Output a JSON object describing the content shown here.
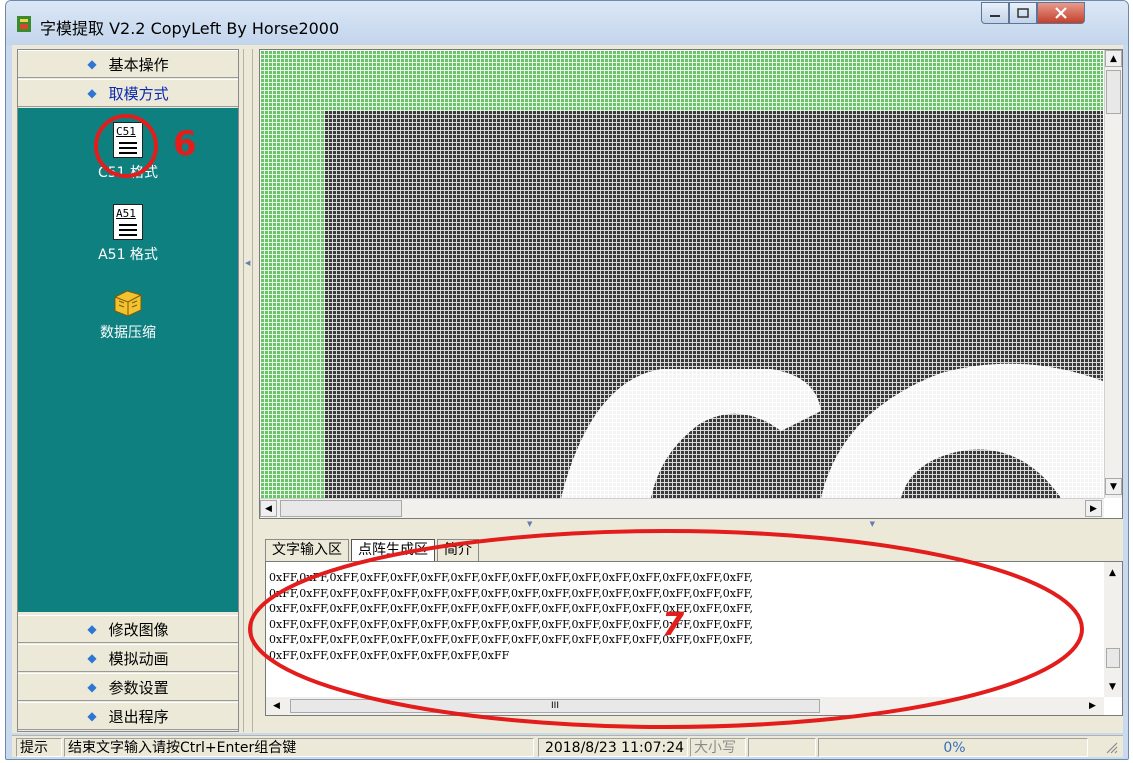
{
  "window": {
    "title": "字模提取 V2.2  CopyLeft By Horse2000"
  },
  "nav": {
    "top_items": [
      {
        "label": "基本操作"
      },
      {
        "label": "取模方式"
      }
    ],
    "tools": [
      {
        "icon_text": "C51",
        "label": "C51 格式",
        "icon": "c51-file-icon"
      },
      {
        "icon_text": "A51",
        "label": "A51 格式",
        "icon": "a51-file-icon"
      },
      {
        "label": "数据压缩",
        "icon": "compress-box-icon"
      }
    ],
    "bottom_items": [
      {
        "label": "修改图像"
      },
      {
        "label": "模拟动画"
      },
      {
        "label": "参数设置"
      },
      {
        "label": "退出程序"
      }
    ]
  },
  "tabs": [
    {
      "label": "文字输入区"
    },
    {
      "label": "点阵生成区"
    },
    {
      "label": "简介"
    }
  ],
  "output": {
    "lines": [
      "0xFF,0xFF,0xFF,0xFF,0xFF,0xFF,0xFF,0xFF,0xFF,0xFF,0xFF,0xFF,0xFF,0xFF,0xFF,0xFF,",
      "0xFF,0xFF,0xFF,0xFF,0xFF,0xFF,0xFF,0xFF,0xFF,0xFF,0xFF,0xFF,0xFF,0xFF,0xFF,0xFF,",
      "0xFF,0xFF,0xFF,0xFF,0xFF,0xFF,0xFF,0xFF,0xFF,0xFF,0xFF,0xFF,0xFF,0xFF,0xFF,0xFF,",
      "0xFF,0xFF,0xFF,0xFF,0xFF,0xFF,0xFF,0xFF,0xFF,0xFF,0xFF,0xFF,0xFF,0xFF,0xFF,0xFF,",
      "0xFF,0xFF,0xFF,0xFF,0xFF,0xFF,0xFF,0xFF,0xFF,0xFF,0xFF,0xFF,0xFF,0xFF,0xFF,0xFF,",
      "0xFF,0xFF,0xFF,0xFF,0xFF,0xFF,0xFF,0xFF"
    ],
    "hscroll_grip": "III"
  },
  "status": {
    "hint_label": "提示",
    "hint_text": "结束文字输入请按Ctrl+Enter组合键",
    "datetime": "2018/8/23 11:07:24",
    "case_indicator": "大小写",
    "progress": "0%"
  },
  "annotations": [
    {
      "label": "6"
    },
    {
      "label": "7"
    }
  ],
  "colors": {
    "nav_panel": "#0f8080",
    "matrix_green": "#69c368",
    "matrix_dark": "#3a3a3a",
    "annotation_red": "#e31c1c",
    "active_nav_text": "#0a2bb0"
  }
}
